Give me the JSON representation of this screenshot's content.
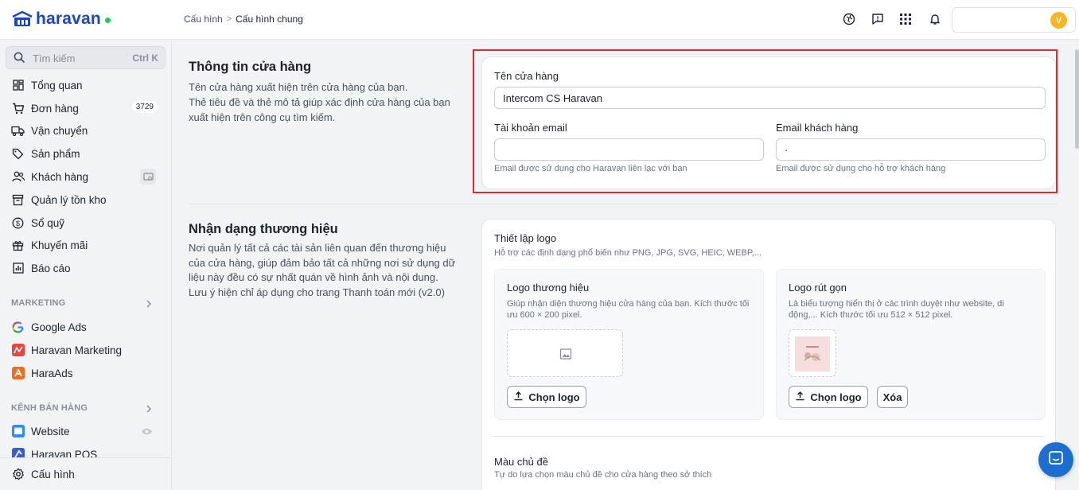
{
  "brand": {
    "name": "haravan"
  },
  "breadcrumb": {
    "parent": "Cấu hình",
    "separator": ">",
    "current": "Cấu hình chung"
  },
  "header": {
    "avatar_initial": "V"
  },
  "sidebar": {
    "search": {
      "placeholder": "Tìm kiếm",
      "shortcut": "Ctrl K"
    },
    "items": [
      {
        "label": "Tổng quan",
        "icon": "dashboard-icon"
      },
      {
        "label": "Đơn hàng",
        "icon": "cart-icon",
        "badge": "3729"
      },
      {
        "label": "Vận chuyển",
        "icon": "truck-icon"
      },
      {
        "label": "Sản phẩm",
        "icon": "tag-icon"
      },
      {
        "label": "Khách hàng",
        "icon": "users-icon"
      },
      {
        "label": "Quản lý tồn kho",
        "icon": "inventory-icon"
      },
      {
        "label": "Sổ quỹ",
        "icon": "dollar-icon"
      },
      {
        "label": "Khuyến mãi",
        "icon": "gift-icon"
      },
      {
        "label": "Báo cáo",
        "icon": "chart-icon"
      }
    ],
    "marketing": {
      "title": "MARKETING",
      "items": [
        {
          "label": "Google Ads",
          "icon": "google-icon"
        },
        {
          "label": "Haravan Marketing",
          "icon": "haravan-marketing-icon"
        },
        {
          "label": "HaraAds",
          "icon": "haraads-icon"
        }
      ]
    },
    "sales_channels": {
      "title": "KÊNH BÁN HÀNG",
      "items": [
        {
          "label": "Website",
          "icon": "website-icon"
        },
        {
          "label": "Haravan POS",
          "icon": "pos-icon"
        }
      ]
    },
    "footer": {
      "label": "Cấu hình",
      "icon": "gear-icon"
    }
  },
  "store_info": {
    "title": "Thông tin cửa hàng",
    "desc1": "Tên cửa hàng xuất hiện trên cửa hàng của bạn.",
    "desc2": "Thẻ tiêu đề và thẻ mô tả giúp xác định cửa hàng của bạn xuất hiện trên công cụ tìm kiếm.",
    "store_name_label": "Tên cửa hàng",
    "store_name_value": "Intercom CS Haravan",
    "account_email_label": "Tài khoản email",
    "account_email_value": "",
    "account_email_hint": "Email được sử dụng cho Haravan liên lạc với bạn",
    "customer_email_label": "Email khách hàng",
    "customer_email_value": "·",
    "customer_email_hint": "Email được sử dụng cho hỗ trợ khách hàng"
  },
  "brand_identity": {
    "title": "Nhận dạng thương hiệu",
    "desc1": "Nơi quản lý tất cả các tài sản liên quan đến thương hiệu của cửa hàng, giúp đảm bảo tất cả những nơi sử dụng dữ liệu này đều có sự nhất quán về hình ảnh và nội dung.",
    "desc2": "Lưu ý hiện chỉ áp dụng cho trang Thanh toán mới (v2.0)",
    "logo_setup_title": "Thiết lập logo",
    "logo_setup_desc": "Hỗ trợ các định dạng phổ biến như PNG, JPG, SVG, HEIC, WEBP,...",
    "brand_logo": {
      "title": "Logo thương hiệu",
      "desc": "Giúp nhận diện thương hiệu cửa hàng của bạn. Kích thước tối ưu 600 × 200 pixel.",
      "button": "Chọn logo"
    },
    "short_logo": {
      "title": "Logo rút gọn",
      "desc": "Là biểu tượng hiển thị ở các trình duyệt như website, di động,... Kích thước tối ưu 512 × 512 pixel.",
      "button": "Chọn logo",
      "delete_button": "Xóa"
    },
    "theme_color_title": "Màu chủ đề",
    "theme_color_desc": "Tự do lựa chọn màu chủ đề cho cửa hàng theo sở thích"
  }
}
